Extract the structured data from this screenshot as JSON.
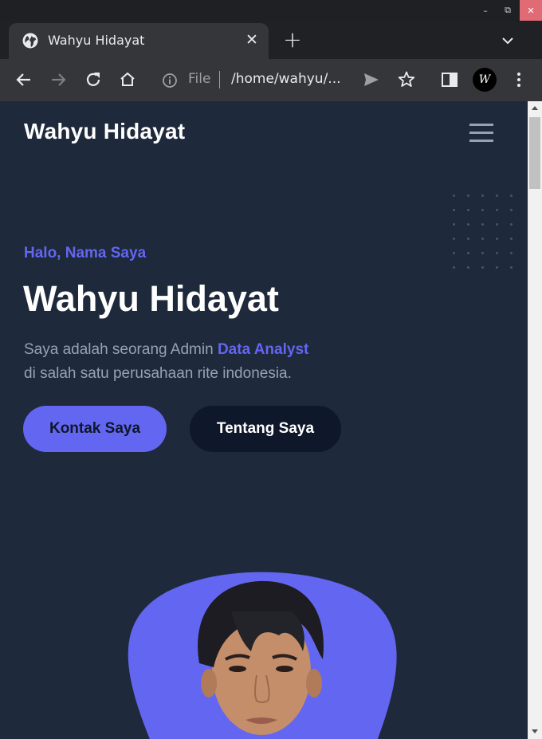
{
  "browser": {
    "window_controls": {
      "minimize": "–",
      "maximize": "⧉",
      "close": "✕"
    },
    "tab": {
      "title": "Wahyu Hidayat",
      "icon": "globe-icon",
      "close_glyph": "✕"
    },
    "new_tab_glyph": "+",
    "address_bar": {
      "scheme_label": "File",
      "url": "/home/wahyu/..."
    },
    "profile_initials": "W",
    "colors": {
      "chrome_dark": "#1f2023",
      "chrome": "#35363a",
      "chrome_text": "#e8eaed"
    }
  },
  "page": {
    "brand": "Wahyu Hidayat",
    "menu_icon": "hamburger-menu-icon",
    "hero": {
      "greeting": "Halo, Nama Saya",
      "name": "Wahyu Hidayat",
      "description_prefix": "Saya adalah seorang Admin ",
      "description_highlight": "Data Analyst",
      "description_suffix": "di salah satu perusahaan rite indonesia.",
      "primary_button": "Kontak Saya",
      "secondary_button": "Tentang Saya"
    },
    "colors": {
      "background": "#1e293b",
      "accent": "#6366f1",
      "muted_text": "#94a3b8",
      "dark_button": "#0f172a"
    }
  }
}
